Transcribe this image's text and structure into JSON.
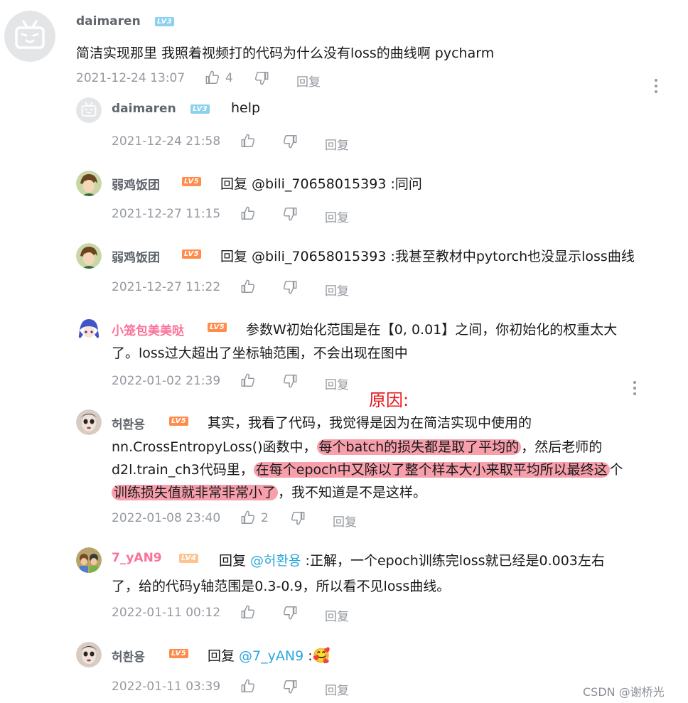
{
  "main_comment": {
    "username": "daimaren",
    "level": "LV3",
    "text": "简洁实现那里 我照着视频打的代码为什么没有loss的曲线啊 pycharm",
    "time": "2021-12-24 13:07",
    "likes": "4",
    "reply_label": "回复"
  },
  "replies": [
    {
      "username": "daimaren",
      "level": "LV3",
      "text": "help",
      "time": "2021-12-24 21:58",
      "reply_label": "回复"
    },
    {
      "username": "弱鸡饭团",
      "level": "LV5",
      "text": "回复 @bili_70658015393 :同问",
      "time": "2021-12-27 11:15",
      "reply_label": "回复"
    },
    {
      "username": "弱鸡饭团",
      "level": "LV5",
      "text": "回复 @bili_70658015393 :我甚至教材中pytorch也没显示loss曲线",
      "time": "2021-12-27 11:22",
      "reply_label": "回复"
    },
    {
      "username": "小笼包美美哒",
      "level": "LV5",
      "text_line1": "参数W初始化范围是在【0, 0.01】之间，你初始化的权重太大",
      "text_line2": "了。loss过大超出了坐标轴范围，不会出现在图中",
      "time": "2022-01-02 21:39",
      "reply_label": "回复"
    },
    {
      "username": "허환용",
      "level": "LV5",
      "text_line1": "其实，我看了代码，我觉得是因为在简洁实现中使用的",
      "text_line2_a": "nn.CrossEntropyLoss()函数中，",
      "text_line2_hl": "每个batch的损失都是取了平均的",
      "text_line2_b": "，然后老师的",
      "text_line3_a": "d2l.train_ch3代码里，",
      "text_line3_hl": "在每个epoch中又除以了整个样本大小来取平均所以最终这",
      "text_line3_b": "个",
      "text_line4_hl": "训练损失值就非常非常小了",
      "text_line4_b": "，我不知道是不是这样。",
      "time": "2022-01-08 23:40",
      "likes": "2",
      "reply_label": "回复"
    },
    {
      "username": "7_yAN9",
      "level": "LV4",
      "text_prefix": "回复 ",
      "mention": "@허환용",
      "text_line1_rest": " :正解，一个epoch训练完loss就已经是0.003左右",
      "text_line2": "了，给的代码y轴范围是0.3-0.9，所以看不见loss曲线。",
      "time": "2022-01-11 00:12",
      "reply_label": "回复"
    },
    {
      "username": "허환용",
      "level": "LV5",
      "text_prefix": "回复 ",
      "mention": "@7_yAN9",
      "text_rest": " :",
      "emoji": "🥰",
      "time": "2022-01-11 03:39",
      "reply_label": "回复"
    }
  ],
  "annotation": {
    "text": "原因:",
    "color": "#e8141a"
  },
  "watermark": "CSDN @谢桥光",
  "colors": {
    "level3": "#8bd1ee",
    "level4": "#fdc491",
    "level5": "#ff8c4a",
    "mention": "#2ba7dd",
    "highlight": "#f05064"
  },
  "icons": [
    "bilibili-tv-avatar-icon",
    "thumbs-up-icon",
    "thumbs-down-icon",
    "more-dots-icon"
  ]
}
